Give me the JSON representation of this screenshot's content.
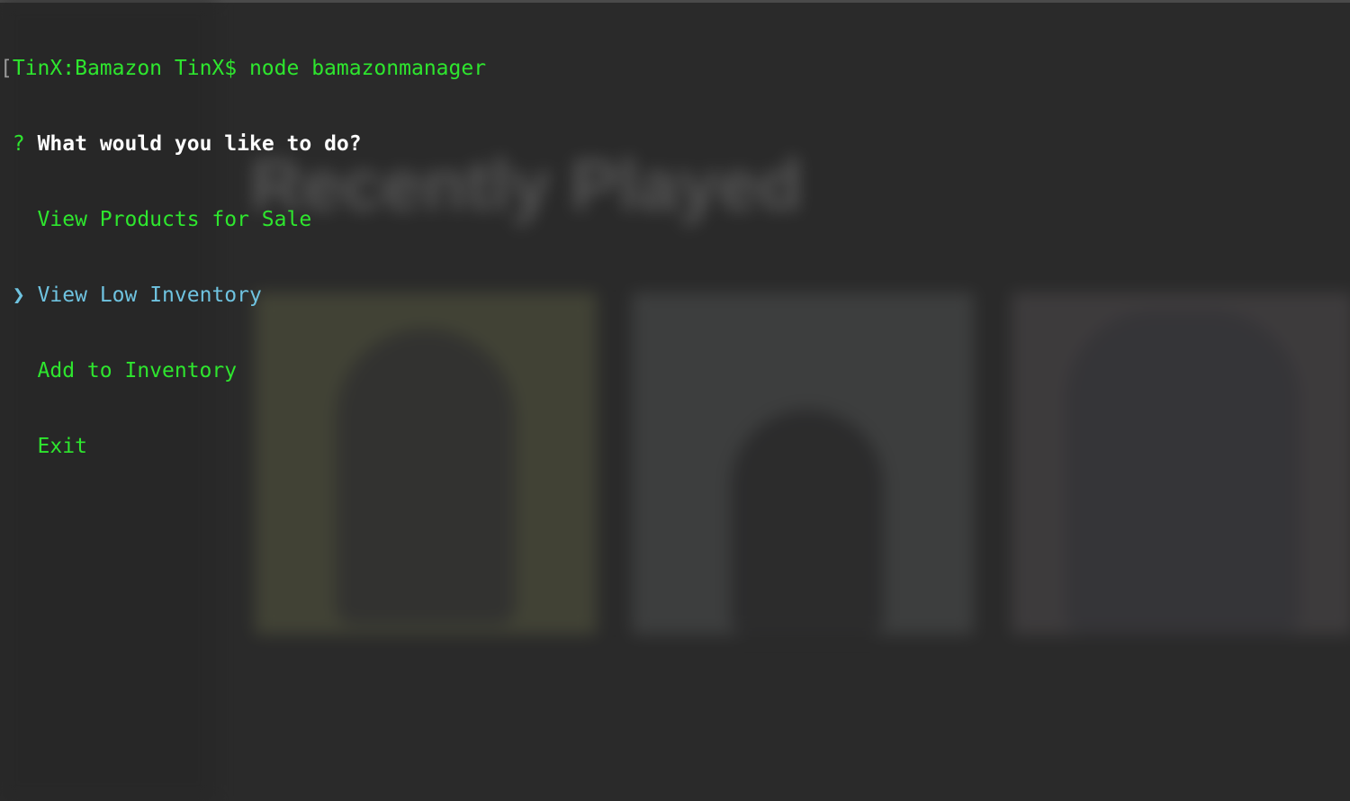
{
  "terminal": {
    "open_bracket": "[",
    "prompt": "TinX:Bamazon TinX$ node bamazonmanager",
    "question_mark": "?",
    "question": "What would you like to do?",
    "pointer": "❯",
    "options": [
      {
        "label": "View Products for Sale",
        "selected": false
      },
      {
        "label": "View Low Inventory",
        "selected": true
      },
      {
        "label": "Add to Inventory",
        "selected": false
      },
      {
        "label": "Exit",
        "selected": false
      }
    ]
  },
  "colors": {
    "background": "#2a2a2a",
    "prompt_green": "#2ee62e",
    "selected_cyan": "#6fc3e0",
    "question_white": "#ffffff"
  },
  "background_app": {
    "heading": "Recently Played",
    "cards": [
      {
        "title": "",
        "subtitle": ""
      },
      {
        "title": "",
        "subtitle": ""
      },
      {
        "title": "",
        "subtitle": ""
      }
    ]
  }
}
